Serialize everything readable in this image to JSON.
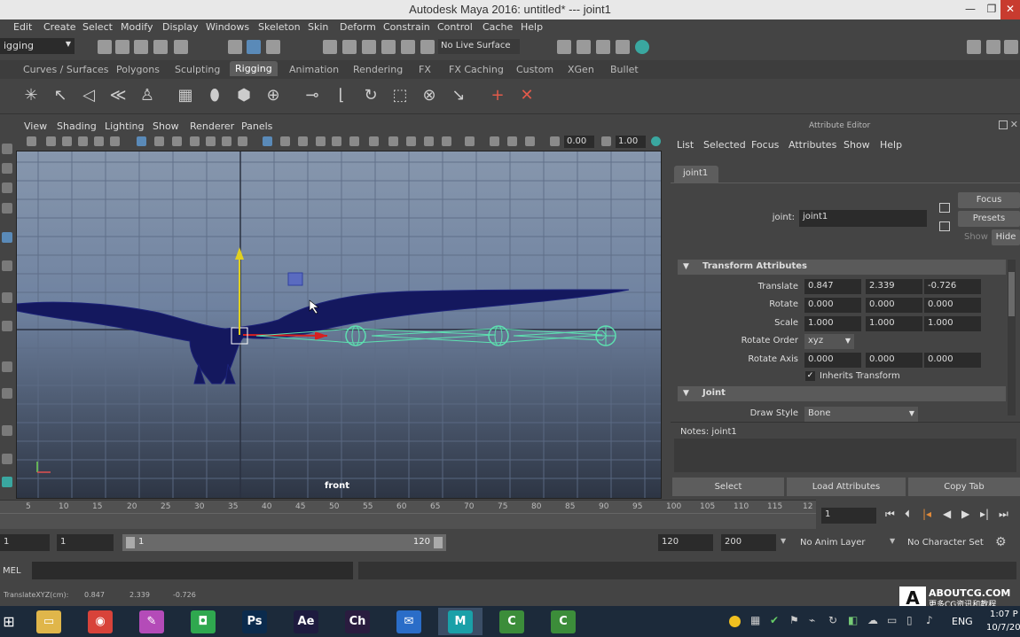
{
  "window": {
    "title": "Autodesk Maya 2016: untitled*   ---   joint1"
  },
  "menubar": [
    "Edit",
    "Create",
    "Select",
    "Modify",
    "Display",
    "Windows",
    "Skeleton",
    "Skin",
    "Deform",
    "Constrain",
    "Control",
    "Cache",
    "Help"
  ],
  "statusline": {
    "mode": "igging",
    "live_surface": "No Live Surface"
  },
  "shelf_tabs": [
    "Curves / Surfaces",
    "Polygons",
    "Sculpting",
    "Rigging",
    "Animation",
    "Rendering",
    "FX",
    "FX Caching",
    "Custom",
    "XGen",
    "Bullet"
  ],
  "shelf_tab_active": "Rigging",
  "viewport": {
    "menu": [
      "View",
      "Shading",
      "Lighting",
      "Show",
      "Renderer",
      "Panels"
    ],
    "field_a": "0.00",
    "field_b": "1.00",
    "camera_label": "front"
  },
  "attribute_editor": {
    "title": "Attribute Editor",
    "menu": [
      "List",
      "Selected",
      "Focus",
      "Attributes",
      "Show",
      "Help"
    ],
    "tab": "joint1",
    "node_label": "joint:",
    "node_name": "joint1",
    "focus_btn": "Focus",
    "presets_btn": "Presets",
    "show_label": "Show",
    "hide_btn": "Hide",
    "section_transform": "Transform Attributes",
    "translate_label": "Translate",
    "translate": [
      "0.847",
      "2.339",
      "-0.726"
    ],
    "rotate_label": "Rotate",
    "rotate": [
      "0.000",
      "0.000",
      "0.000"
    ],
    "scale_label": "Scale",
    "scale": [
      "1.000",
      "1.000",
      "1.000"
    ],
    "rotate_order_label": "Rotate Order",
    "rotate_order": "xyz",
    "rotate_axis_label": "Rotate Axis",
    "rotate_axis": [
      "0.000",
      "0.000",
      "0.000"
    ],
    "inherits_label": "Inherits Transform",
    "section_joint": "Joint",
    "draw_style_label": "Draw Style",
    "draw_style": "Bone",
    "notes_label": "Notes:  joint1",
    "bottom_buttons": [
      "Select",
      "Load Attributes",
      "Copy Tab"
    ]
  },
  "timeslider": {
    "ticks": [
      "5",
      "10",
      "15",
      "20",
      "25",
      "30",
      "35",
      "40",
      "45",
      "50",
      "55",
      "60",
      "65",
      "70",
      "75",
      "80",
      "85",
      "90",
      "95",
      "100",
      "105",
      "110",
      "115",
      "12"
    ],
    "current_frame": "1"
  },
  "range": {
    "start": "1",
    "range_start": "1",
    "range_end": "120",
    "end": "120",
    "anim_end": "200",
    "anim_layer": "No Anim Layer",
    "character_set": "No Character Set"
  },
  "cmdline": {
    "label": "MEL"
  },
  "helpline": {
    "label": "TranslateXYZ(cm):",
    "x": "0.847",
    "y": "2.339",
    "z": "-0.726"
  },
  "watermark": {
    "site": "ABOUTCG.COM",
    "tagline": "更多CG资讯和教程"
  },
  "taskbar": {
    "apps": [
      {
        "name": "file-explorer",
        "glyph": "▭",
        "color": "#e0b64a"
      },
      {
        "name": "chrome",
        "glyph": "◉",
        "color": "#d8433a"
      },
      {
        "name": "paint-app",
        "glyph": "✎",
        "color": "#b44bb8"
      },
      {
        "name": "media-app",
        "glyph": "◘",
        "color": "#2fa84f"
      },
      {
        "name": "photoshop",
        "glyph": "Ps",
        "color": "#0b2b4d"
      },
      {
        "name": "after-effects",
        "glyph": "Ae",
        "color": "#1e1b3f"
      },
      {
        "name": "character-animator",
        "glyph": "Ch",
        "color": "#2a1c3f"
      },
      {
        "name": "mail",
        "glyph": "✉",
        "color": "#2a6dc8"
      },
      {
        "name": "maya",
        "glyph": "M",
        "color": "#1aa0a8"
      },
      {
        "name": "camtasia",
        "glyph": "C",
        "color": "#3c8d3a"
      },
      {
        "name": "camtasia-2",
        "glyph": "C",
        "color": "#3c8d3a"
      }
    ],
    "language": "ENG",
    "time": "1:07 P",
    "date": "10/7/20"
  }
}
